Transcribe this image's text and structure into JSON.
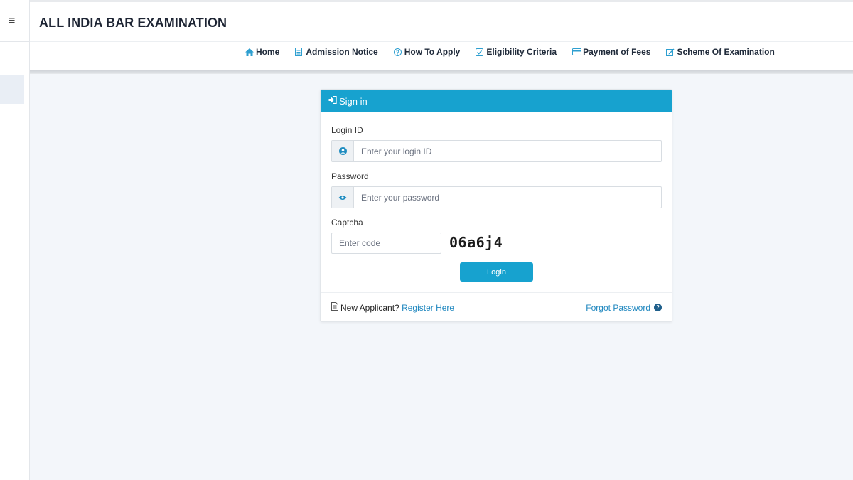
{
  "app": {
    "title": "ALL INDIA BAR EXAMINATION"
  },
  "nav": {
    "items": [
      {
        "label": "Home",
        "icon": "home-icon"
      },
      {
        "label": "Admission Notice",
        "icon": "document-icon"
      },
      {
        "label": "How To Apply",
        "icon": "question-circle-icon"
      },
      {
        "label": "Eligibility Criteria",
        "icon": "check-square-icon"
      },
      {
        "label": "Payment of Fees",
        "icon": "credit-card-icon"
      },
      {
        "label": "Scheme Of Examination",
        "icon": "edit-icon"
      }
    ]
  },
  "signin": {
    "heading": "Sign in",
    "login_id_label": "Login ID",
    "login_id_placeholder": "Enter your login ID",
    "login_id_value": "",
    "password_label": "Password",
    "password_placeholder": "Enter your password",
    "password_value": "",
    "captcha_label": "Captcha",
    "captcha_placeholder": "Enter code",
    "captcha_value": "",
    "captcha_code": "06a6j4",
    "login_button": "Login",
    "new_applicant_text": "New Applicant?",
    "register_link": "Register Here",
    "forgot_link": "Forgot Password"
  },
  "colors": {
    "accent": "#17a2cf",
    "link": "#1f87bf",
    "background": "#f3f6fa"
  }
}
